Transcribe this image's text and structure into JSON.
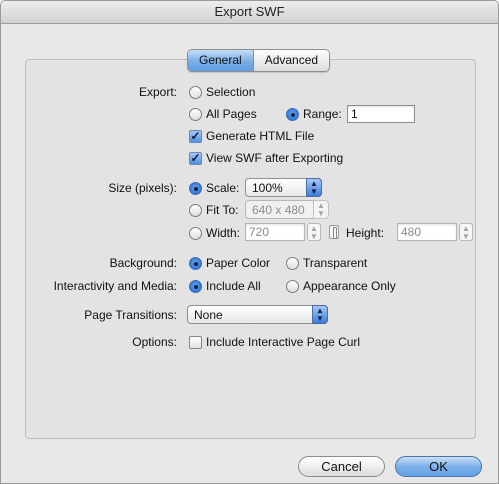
{
  "window": {
    "title": "Export SWF"
  },
  "tabs": [
    {
      "label": "General",
      "active": true
    },
    {
      "label": "Advanced",
      "active": false
    }
  ],
  "export": {
    "label": "Export:",
    "selection_label": "Selection",
    "all_pages_label": "All Pages",
    "range_label": "Range:",
    "range_value": "1",
    "selected": "Range",
    "generate_html_label": "Generate HTML File",
    "generate_html_checked": true,
    "view_swf_label": "View SWF after Exporting",
    "view_swf_checked": true
  },
  "size": {
    "label": "Size (pixels):",
    "scale_label": "Scale:",
    "scale_value": "100%",
    "fit_to_label": "Fit To:",
    "fit_to_value": "640 x 480",
    "width_label": "Width:",
    "width_value": "720",
    "height_label": "Height:",
    "height_value": "480",
    "selected": "Scale"
  },
  "background": {
    "label": "Background:",
    "paper_color_label": "Paper Color",
    "transparent_label": "Transparent",
    "selected": "Paper Color"
  },
  "interactivity": {
    "label": "Interactivity and Media:",
    "include_all_label": "Include All",
    "appearance_only_label": "Appearance Only",
    "selected": "Include All"
  },
  "page_transitions": {
    "label": "Page Transitions:",
    "value": "None"
  },
  "options": {
    "label": "Options:",
    "page_curl_label": "Include Interactive Page Curl",
    "page_curl_checked": false
  },
  "buttons": {
    "cancel": "Cancel",
    "ok": "OK"
  },
  "colors": {
    "accent": "#5f9de3",
    "window_bg": "#e8e8e8",
    "panel_bg": "#e3e3e3"
  }
}
